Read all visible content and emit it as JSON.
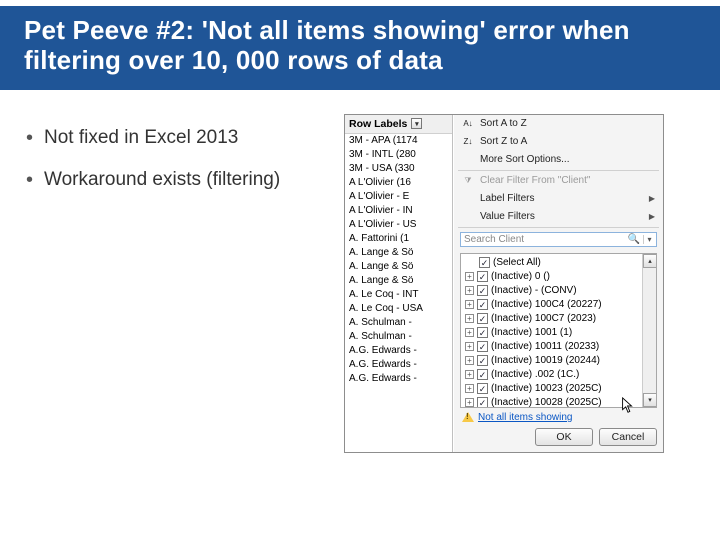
{
  "title": "Pet Peeve #2: 'Not all items showing' error when filtering over 10, 000 rows of data",
  "bullets": [
    "Not fixed in Excel 2013",
    "Workaround exists (filtering)"
  ],
  "excel": {
    "row_labels_header": "Row Labels",
    "row_labels": [
      "3M - APA (1174",
      "3M - INTL (280",
      "3M - USA (330",
      "A L'Olivier (16",
      "A L'Olivier - E",
      "A L'Olivier - IN",
      "A L'Olivier - US",
      "A. Fattorini (1",
      "A. Lange & Sö",
      "A. Lange & Sö",
      "A. Lange & Sö",
      "A. Le Coq - INT",
      "A. Le Coq - USA",
      "A. Schulman -",
      "A. Schulman -",
      "A.G. Edwards -",
      "A.G. Edwards -",
      "A.G. Edwards -"
    ],
    "menu": {
      "sort_az": "Sort A to Z",
      "sort_za": "Sort Z to A",
      "more_sort": "More Sort Options...",
      "clear_filter": "Clear Filter From \"Client\"",
      "label_filters": "Label Filters",
      "value_filters": "Value Filters",
      "search_placeholder": "Search Client"
    },
    "checks": [
      "(Select All)",
      "(Inactive) 0 ()",
      "(Inactive) - (CONV)",
      "(Inactive) 100C4 (20227)",
      "(Inactive) 100C7 (2023)",
      "(Inactive) 1001 (1)",
      "(Inactive) 10011 (20233)",
      "(Inactive) 10019 (20244)",
      "(Inactive) .002 (1C.)",
      "(Inactive) 10023 (2025C)",
      "(Inactive) 10028 (2025C)"
    ],
    "warning": "Not all items showing",
    "ok": "OK",
    "cancel": "Cancel"
  }
}
